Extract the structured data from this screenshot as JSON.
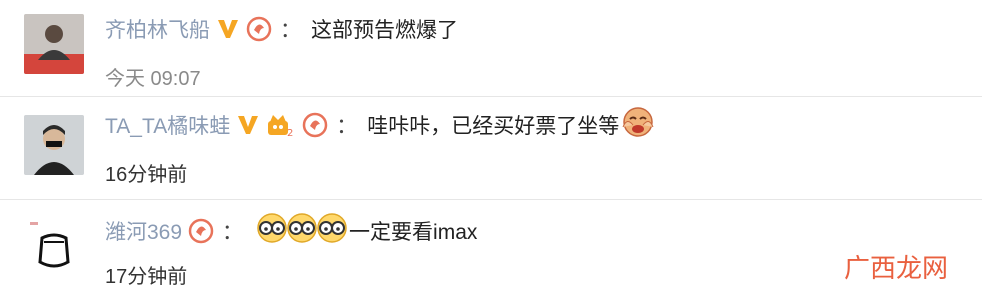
{
  "comments": [
    {
      "username": "齐柏林飞船",
      "badges": [
        "verified-v-icon",
        "fan-badge-icon"
      ],
      "text": "这部预告燃爆了",
      "time": "今天 09:07"
    },
    {
      "username": "TA_TA橘味蛙",
      "badges": [
        "verified-v-icon",
        "crown-level-badge-icon",
        "fan-badge-icon"
      ],
      "text": "哇咔咔，已经买好票了坐等",
      "trailing_emoji": "clapping-face-emoji",
      "time": "16分钟前"
    },
    {
      "username": "潍河369",
      "badges": [
        "fan-badge-icon"
      ],
      "leading_emojis": [
        "glasses-face-emoji",
        "glasses-face-emoji",
        "glasses-face-emoji"
      ],
      "text": "一定要看imax",
      "time": "17分钟前"
    }
  ],
  "colon": "：",
  "crown_level": "2",
  "watermark": "广西龙网",
  "colors": {
    "username": "#8a9bb4",
    "verified": "#f5a623",
    "fan_badge": "#e8735a",
    "watermark": "#e9603f"
  }
}
